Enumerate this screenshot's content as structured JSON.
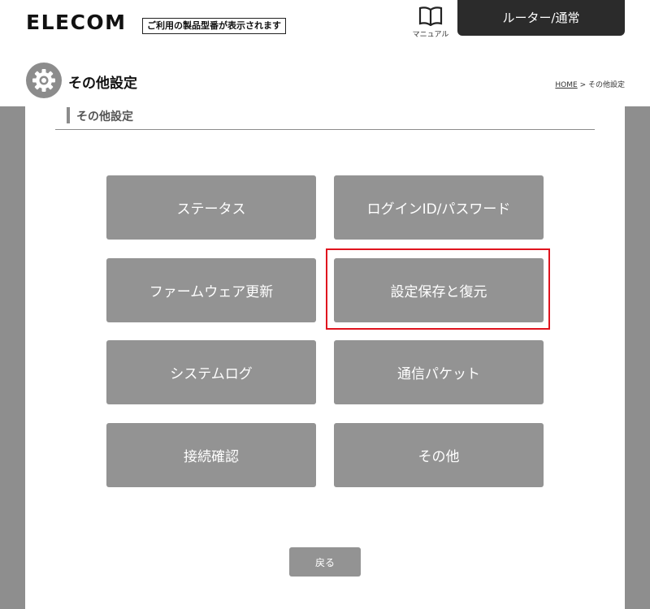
{
  "header": {
    "logo": "ELECOM",
    "model_label": "ご利用の製品型番が表示されます",
    "manual_label": "マニュアル",
    "mode_label": "ルーター/通常"
  },
  "page": {
    "title": "その他設定",
    "breadcrumb_home": "HOME",
    "breadcrumb_sep": " > ",
    "breadcrumb_current": "その他設定"
  },
  "section": {
    "title": "その他設定"
  },
  "menu": [
    {
      "label": "ステータス"
    },
    {
      "label": "ログインID/パスワード"
    },
    {
      "label": "ファームウェア更新"
    },
    {
      "label": "設定保存と復元"
    },
    {
      "label": "システムログ"
    },
    {
      "label": "通信パケット"
    },
    {
      "label": "接続確認"
    },
    {
      "label": "その他"
    }
  ],
  "back_label": "戻る",
  "colors": {
    "highlight": "#e0141e",
    "button": "#939393",
    "frame": "#8e8e8e"
  }
}
